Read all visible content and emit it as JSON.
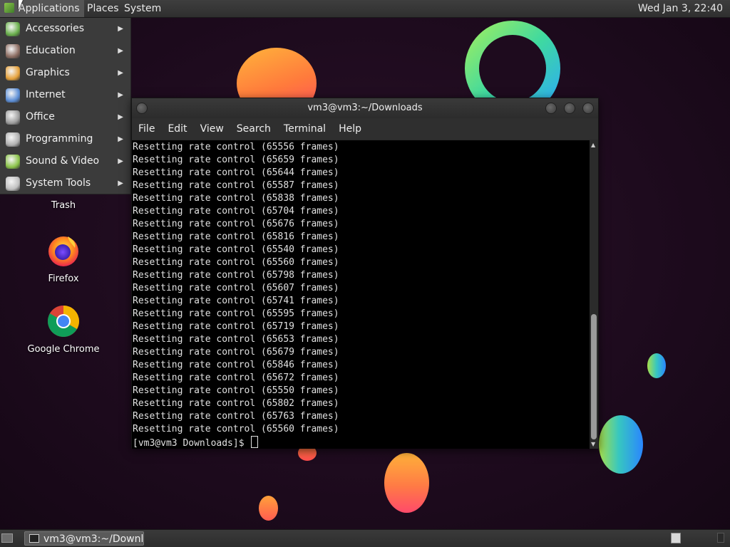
{
  "top_panel": {
    "applications": "Applications",
    "places": "Places",
    "system": "System",
    "clock": "Wed Jan  3, 22:40"
  },
  "apps_menu": {
    "items": [
      {
        "label": "Accessories",
        "icon": "accessories-icon",
        "color": "#6ab04c"
      },
      {
        "label": "Education",
        "icon": "education-icon",
        "color": "#8d6e63"
      },
      {
        "label": "Graphics",
        "icon": "graphics-icon",
        "color": "#e6a23c"
      },
      {
        "label": "Internet",
        "icon": "internet-icon",
        "color": "#5c8ed6"
      },
      {
        "label": "Office",
        "icon": "office-icon",
        "color": "#9e9e9e"
      },
      {
        "label": "Programming",
        "icon": "programming-icon",
        "color": "#b0b0b0"
      },
      {
        "label": "Sound & Video",
        "icon": "sound-video-icon",
        "color": "#8bc34a"
      },
      {
        "label": "System Tools",
        "icon": "system-tools-icon",
        "color": "#c0c0c0"
      }
    ]
  },
  "desktop": {
    "trash_label": "Trash",
    "firefox_label": "Firefox",
    "chrome_label": "Google Chrome"
  },
  "terminal": {
    "title": "vm3@vm3:~/Downloads",
    "menu": [
      "File",
      "Edit",
      "View",
      "Search",
      "Terminal",
      "Help"
    ],
    "output_lines": [
      "Resetting rate control (65556 frames)",
      "Resetting rate control (65659 frames)",
      "Resetting rate control (65644 frames)",
      "Resetting rate control (65587 frames)",
      "Resetting rate control (65838 frames)",
      "Resetting rate control (65704 frames)",
      "Resetting rate control (65676 frames)",
      "Resetting rate control (65816 frames)",
      "Resetting rate control (65540 frames)",
      "Resetting rate control (65560 frames)",
      "Resetting rate control (65798 frames)",
      "Resetting rate control (65607 frames)",
      "Resetting rate control (65741 frames)",
      "Resetting rate control (65595 frames)",
      "Resetting rate control (65719 frames)",
      "Resetting rate control (65653 frames)",
      "Resetting rate control (65679 frames)",
      "Resetting rate control (65846 frames)",
      "Resetting rate control (65672 frames)",
      "Resetting rate control (65550 frames)",
      "Resetting rate control (65802 frames)",
      "Resetting rate control (65763 frames)",
      "Resetting rate control (65560 frames)"
    ],
    "prompt": "[vm3@vm3 Downloads]$ "
  },
  "bottom_panel": {
    "task_label": "vm3@vm3:~/Downl..."
  }
}
